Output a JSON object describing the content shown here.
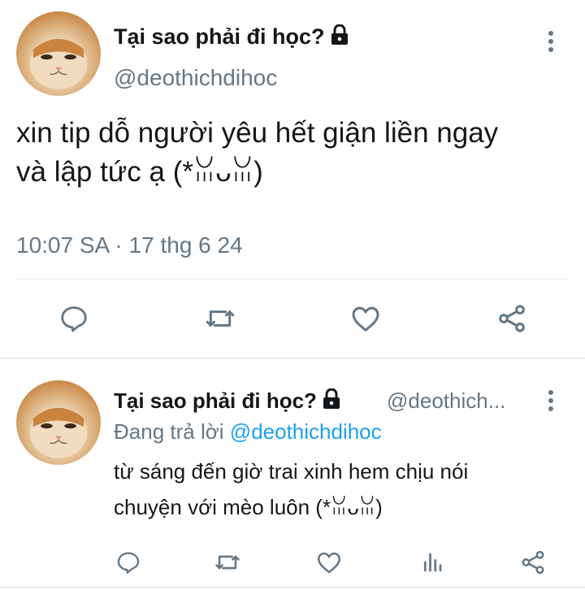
{
  "main_tweet": {
    "display_name": "Tại sao phải đi học?",
    "handle": "@deothichdihoc",
    "text_line1": "xin tip dỗ người yêu hết giận liền ngay",
    "text_line2": "và lập tức ạ (*ꈍᴗꈍ)",
    "timestamp": "10:07 SA · 17 thg 6 24",
    "icons": [
      "reply-icon",
      "retweet-icon",
      "like-icon",
      "share-icon"
    ]
  },
  "reply_tweet": {
    "display_name": "Tại sao phải đi học?",
    "handle": "@deothich...",
    "replying_prefix": "Đang trả lời",
    "replying_mention": "@deothichdihoc",
    "text_line1": "từ sáng đến giờ trai xinh hem chịu nói",
    "text_line2": "chuyện với mèo luôn (*ꈍᴗꈍ)",
    "icons": [
      "reply-icon",
      "retweet-icon",
      "like-icon",
      "analytics-icon",
      "share-icon"
    ]
  },
  "colors": {
    "text": "#14171a",
    "secondary": "#657786",
    "accent": "#1da1f2",
    "divider": "#e1e8ed"
  }
}
